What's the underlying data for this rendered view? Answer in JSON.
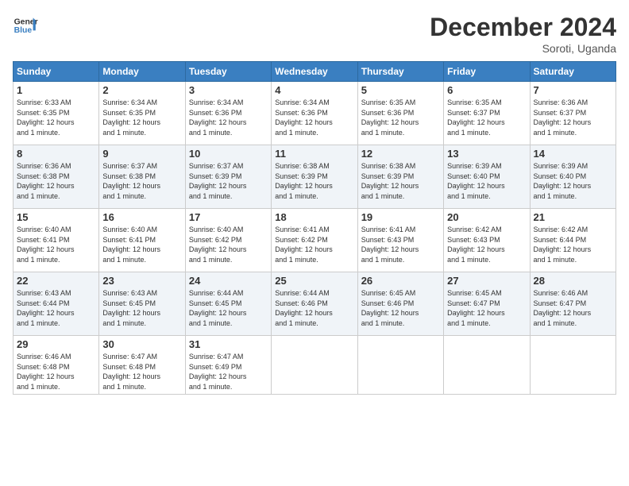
{
  "logo": {
    "general": "General",
    "blue": "Blue"
  },
  "title": "December 2024",
  "location": "Soroti, Uganda",
  "days_of_week": [
    "Sunday",
    "Monday",
    "Tuesday",
    "Wednesday",
    "Thursday",
    "Friday",
    "Saturday"
  ],
  "weeks": [
    [
      {
        "day": "1",
        "sunrise": "6:33 AM",
        "sunset": "6:35 PM",
        "daylight": "12 hours and 1 minute."
      },
      {
        "day": "2",
        "sunrise": "6:34 AM",
        "sunset": "6:35 PM",
        "daylight": "12 hours and 1 minute."
      },
      {
        "day": "3",
        "sunrise": "6:34 AM",
        "sunset": "6:36 PM",
        "daylight": "12 hours and 1 minute."
      },
      {
        "day": "4",
        "sunrise": "6:34 AM",
        "sunset": "6:36 PM",
        "daylight": "12 hours and 1 minute."
      },
      {
        "day": "5",
        "sunrise": "6:35 AM",
        "sunset": "6:36 PM",
        "daylight": "12 hours and 1 minute."
      },
      {
        "day": "6",
        "sunrise": "6:35 AM",
        "sunset": "6:37 PM",
        "daylight": "12 hours and 1 minute."
      },
      {
        "day": "7",
        "sunrise": "6:36 AM",
        "sunset": "6:37 PM",
        "daylight": "12 hours and 1 minute."
      }
    ],
    [
      {
        "day": "8",
        "sunrise": "6:36 AM",
        "sunset": "6:38 PM",
        "daylight": "12 hours and 1 minute."
      },
      {
        "day": "9",
        "sunrise": "6:37 AM",
        "sunset": "6:38 PM",
        "daylight": "12 hours and 1 minute."
      },
      {
        "day": "10",
        "sunrise": "6:37 AM",
        "sunset": "6:39 PM",
        "daylight": "12 hours and 1 minute."
      },
      {
        "day": "11",
        "sunrise": "6:38 AM",
        "sunset": "6:39 PM",
        "daylight": "12 hours and 1 minute."
      },
      {
        "day": "12",
        "sunrise": "6:38 AM",
        "sunset": "6:39 PM",
        "daylight": "12 hours and 1 minute."
      },
      {
        "day": "13",
        "sunrise": "6:39 AM",
        "sunset": "6:40 PM",
        "daylight": "12 hours and 1 minute."
      },
      {
        "day": "14",
        "sunrise": "6:39 AM",
        "sunset": "6:40 PM",
        "daylight": "12 hours and 1 minute."
      }
    ],
    [
      {
        "day": "15",
        "sunrise": "6:40 AM",
        "sunset": "6:41 PM",
        "daylight": "12 hours and 1 minute."
      },
      {
        "day": "16",
        "sunrise": "6:40 AM",
        "sunset": "6:41 PM",
        "daylight": "12 hours and 1 minute."
      },
      {
        "day": "17",
        "sunrise": "6:40 AM",
        "sunset": "6:42 PM",
        "daylight": "12 hours and 1 minute."
      },
      {
        "day": "18",
        "sunrise": "6:41 AM",
        "sunset": "6:42 PM",
        "daylight": "12 hours and 1 minute."
      },
      {
        "day": "19",
        "sunrise": "6:41 AM",
        "sunset": "6:43 PM",
        "daylight": "12 hours and 1 minute."
      },
      {
        "day": "20",
        "sunrise": "6:42 AM",
        "sunset": "6:43 PM",
        "daylight": "12 hours and 1 minute."
      },
      {
        "day": "21",
        "sunrise": "6:42 AM",
        "sunset": "6:44 PM",
        "daylight": "12 hours and 1 minute."
      }
    ],
    [
      {
        "day": "22",
        "sunrise": "6:43 AM",
        "sunset": "6:44 PM",
        "daylight": "12 hours and 1 minute."
      },
      {
        "day": "23",
        "sunrise": "6:43 AM",
        "sunset": "6:45 PM",
        "daylight": "12 hours and 1 minute."
      },
      {
        "day": "24",
        "sunrise": "6:44 AM",
        "sunset": "6:45 PM",
        "daylight": "12 hours and 1 minute."
      },
      {
        "day": "25",
        "sunrise": "6:44 AM",
        "sunset": "6:46 PM",
        "daylight": "12 hours and 1 minute."
      },
      {
        "day": "26",
        "sunrise": "6:45 AM",
        "sunset": "6:46 PM",
        "daylight": "12 hours and 1 minute."
      },
      {
        "day": "27",
        "sunrise": "6:45 AM",
        "sunset": "6:47 PM",
        "daylight": "12 hours and 1 minute."
      },
      {
        "day": "28",
        "sunrise": "6:46 AM",
        "sunset": "6:47 PM",
        "daylight": "12 hours and 1 minute."
      }
    ],
    [
      {
        "day": "29",
        "sunrise": "6:46 AM",
        "sunset": "6:48 PM",
        "daylight": "12 hours and 1 minute."
      },
      {
        "day": "30",
        "sunrise": "6:47 AM",
        "sunset": "6:48 PM",
        "daylight": "12 hours and 1 minute."
      },
      {
        "day": "31",
        "sunrise": "6:47 AM",
        "sunset": "6:49 PM",
        "daylight": "12 hours and 1 minute."
      },
      null,
      null,
      null,
      null
    ]
  ],
  "labels": {
    "sunrise": "Sunrise:",
    "sunset": "Sunset:",
    "daylight": "Daylight:"
  }
}
